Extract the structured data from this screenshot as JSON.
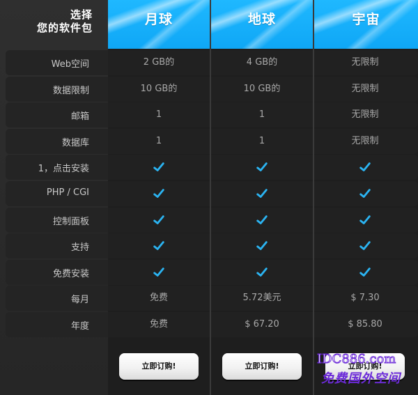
{
  "header": {
    "title_line1": "选择",
    "title_line2": "您的软件包"
  },
  "plans": [
    {
      "name": "月球"
    },
    {
      "name": "地球"
    },
    {
      "name": "宇宙"
    }
  ],
  "rows": [
    {
      "label": "Web空间",
      "values": [
        "2 GB的",
        "4 GB的",
        "无限制"
      ]
    },
    {
      "label": "数据限制",
      "values": [
        "10 GB的",
        "10 GB的",
        "无限制"
      ]
    },
    {
      "label": "邮箱",
      "values": [
        "1",
        "1",
        "无限制"
      ]
    },
    {
      "label": "数据库",
      "values": [
        "1",
        "1",
        "无限制"
      ]
    },
    {
      "label": "1，点击安装",
      "values": [
        "check",
        "check",
        "check"
      ]
    },
    {
      "label": "PHP / CGI",
      "values": [
        "check",
        "check",
        "check"
      ]
    },
    {
      "label": "控制面板",
      "values": [
        "check",
        "check",
        "check"
      ]
    },
    {
      "label": "支持",
      "values": [
        "check",
        "check",
        "check"
      ]
    },
    {
      "label": "免费安装",
      "values": [
        "check",
        "check",
        "check"
      ]
    },
    {
      "label": "每月",
      "values": [
        "免费",
        "5.72美元",
        "$ 7.30"
      ]
    },
    {
      "label": "年度",
      "values": [
        "免费",
        "$ 67.20",
        "$ 85.80"
      ]
    }
  ],
  "order_button_label": "立即订购!",
  "watermark": {
    "line1": "IDC886.com",
    "line2": "免费国外空间"
  },
  "colors": {
    "header_blue": "#15acf8",
    "check_blue": "#2bb4f2",
    "label_text": "#c9c9c9",
    "cell_text": "#a9a9a9",
    "watermark_purple": "#6c2bd9"
  },
  "icons": {
    "check": "check-icon"
  }
}
